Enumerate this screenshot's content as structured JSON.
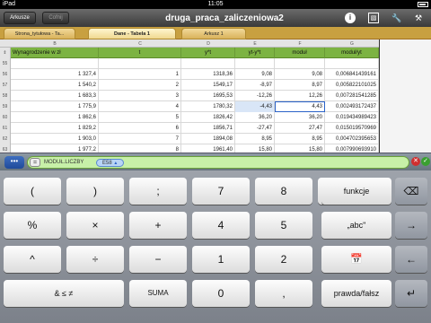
{
  "status": {
    "device": "iPad",
    "time": "11:05",
    "battery_pct": ""
  },
  "toolbar": {
    "sheets_btn": "Arkusze",
    "undo_btn": "Cofnij",
    "title": "druga_praca_zaliczeniowa2"
  },
  "tabs": [
    "Strona_tytułowa - Ta...",
    "Dane - Tabela 1",
    "Arkusz 1"
  ],
  "columns": [
    "B",
    "C",
    "D",
    "E",
    "F",
    "G"
  ],
  "header_row": [
    "Wynagrodzenie w zł",
    "t",
    "y*t",
    "yt-y*t",
    "moduł",
    "moduł/yt"
  ],
  "rows": [
    {
      "n": "55",
      "cells": [
        "",
        "",
        "",
        "",
        "",
        ""
      ]
    },
    {
      "n": "56",
      "cells": [
        "1 327,4",
        "1",
        "1318,36",
        "9,08",
        "9,08",
        "0,006841439161"
      ]
    },
    {
      "n": "57",
      "cells": [
        "1 540,2",
        "2",
        "1549,17",
        "-8,97",
        "8,97",
        "0,005822101025"
      ]
    },
    {
      "n": "58",
      "cells": [
        "1 683,3",
        "3",
        "1695,53",
        "-12,26",
        "12,26",
        "0,007281541285"
      ]
    },
    {
      "n": "59",
      "cells": [
        "1 775,9",
        "4",
        "1780,32",
        "-4,43",
        "4,43",
        "0,002493172437"
      ]
    },
    {
      "n": "60",
      "cells": [
        "1 862,6",
        "5",
        "1826,42",
        "36,20",
        "36,20",
        "0,019434989423"
      ]
    },
    {
      "n": "61",
      "cells": [
        "1 829,2",
        "6",
        "1856,71",
        "-27,47",
        "27,47",
        "0,015019570969"
      ]
    },
    {
      "n": "62",
      "cells": [
        "1 903,0",
        "7",
        "1894,08",
        "8,95",
        "8,95",
        "0,004702395653"
      ]
    },
    {
      "n": "63",
      "cells": [
        "1 977,2",
        "8",
        "1961,40",
        "15,80",
        "15,80",
        "0,007990693910"
      ]
    }
  ],
  "bottom_row": {
    "n": "64",
    "cells": [
      "2 578,3",
      "11",
      "2571,88",
      "6,38",
      "6,38",
      "0,002474398947"
    ]
  },
  "formula": {
    "more": "•••",
    "eq": "=",
    "func": "MODUŁ.LICZBY",
    "token": "E58",
    "token_arrow": "▲"
  },
  "keys": {
    "row1": [
      "(",
      ")",
      ";",
      "7",
      "8",
      "9",
      "funkcje",
      "⌫"
    ],
    "row2": [
      "%",
      "×",
      "+",
      "4",
      "5",
      "6",
      "„abc\"",
      "→"
    ],
    "row3": [
      "^",
      "÷",
      "−",
      "1",
      "2",
      "3",
      "",
      "←"
    ],
    "row4": [
      "& ≤ ≠",
      "SUMA",
      "0",
      ",",
      "prawda/fałsz",
      "↵"
    ]
  }
}
